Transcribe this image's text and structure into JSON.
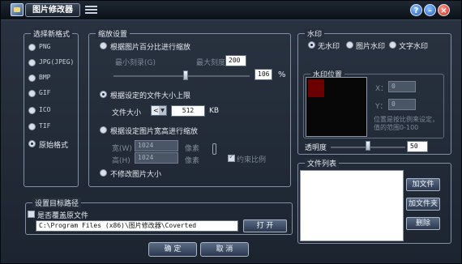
{
  "titlebar": {
    "title": "图片修改器",
    "help_label": "?",
    "minimize_label": "–",
    "close_label": "×"
  },
  "format_group": {
    "title": "选择新格式",
    "options": [
      "PNG",
      "JPG(JPEG)",
      "BMP",
      "GIF",
      "ICO",
      "TIF",
      "原始格式"
    ],
    "selected": "原始格式"
  },
  "resize_group": {
    "title": "缩放设置",
    "percent_option": "根据图片百分比进行缩放",
    "min_scale_label": "最小刻录(G)",
    "max_scale_label": "最大刻度",
    "max_scale_value": "200",
    "percent_value": "106",
    "percent_unit": "%",
    "percent_slider": 0.53,
    "filesize_option": "根据设定的文件大小上限",
    "filesize_label": "文件大小",
    "filesize_operator": "<=",
    "filesize_value": "512",
    "filesize_unit": "KB",
    "wh_option": "根据设定图片宽高进行缩放",
    "width_label": "宽(W)",
    "width_value": "1024",
    "width_unit": "像素",
    "height_label": "高(H)",
    "height_value": "1024",
    "height_unit": "像素",
    "constrain_label": "约束比例",
    "constrain_checked": true,
    "nochange_option": "不修改图片大小",
    "selected": "根据设定的文件大小上限"
  },
  "watermark_group": {
    "title": "水印",
    "options": [
      "无水印",
      "图片水印",
      "文字水印"
    ],
    "selected": "无水印",
    "position_title": "水印位置",
    "x_label": "X：",
    "x_value": "0",
    "y_label": "Y：",
    "y_value": "0",
    "position_hint": "位置是按比例来设定，值的范围0-100",
    "opacity_label": "透明度",
    "opacity_value": "50",
    "opacity_slider": 0.5,
    "preview_mark_color": "#6b0000"
  },
  "filelist_group": {
    "title": "文件列表",
    "add_file_button": "加文件",
    "add_folder_button": "加文件夹",
    "delete_button": "删除",
    "files": []
  },
  "output_group": {
    "title": "设置目标路径",
    "overwrite_label": "是否覆盖原文件",
    "overwrite_checked": false,
    "path_value": "C:\\Program Files (x86)\\图片修改器\\Coverted",
    "open_button": "打 开"
  },
  "footer": {
    "ok_button": "确 定",
    "cancel_button": "取 消"
  },
  "colors": {
    "window_bg": "#252e3b",
    "titlebar_bg": "#0c1118",
    "group_border": "#7f8fa4",
    "button_bg": "#3a4a64",
    "close_button": "#c72a1f"
  }
}
